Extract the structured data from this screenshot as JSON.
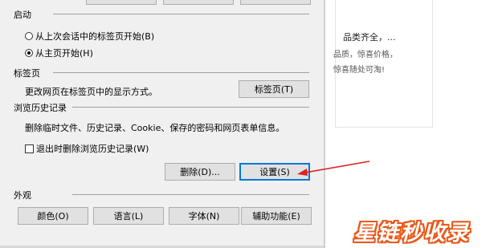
{
  "startup": {
    "title": "启动",
    "option_last_session": "从上次会话中的标签页开始(B)",
    "option_home": "从主页开始(H)"
  },
  "tabs": {
    "title": "标签页",
    "description": "更改网页在标签页中的显示方式。",
    "button": "标签页(T)"
  },
  "history": {
    "title": "浏览历史记录",
    "description": "删除临时文件、历史记录、Cookie、保存的密码和网页表单信息。",
    "delete_on_exit": "退出时删除浏览历史记录(W)",
    "delete_button": "删除(D)...",
    "settings_button": "设置(S)"
  },
  "appearance": {
    "title": "外观",
    "colors_button": "颜色(O)",
    "languages_button": "语言(L)",
    "fonts_button": "字体(N)",
    "accessibility_button": "辅助功能(E)"
  },
  "background_page": {
    "line1": "品类齐全，...",
    "line2": "品质，惊喜价格，",
    "line3": "惊喜随处可淘!"
  },
  "watermark": "星链秒收录",
  "colors": {
    "arrow": "#e02020",
    "focus_border": "#0078d7",
    "watermark_outline": "#e8591a"
  }
}
